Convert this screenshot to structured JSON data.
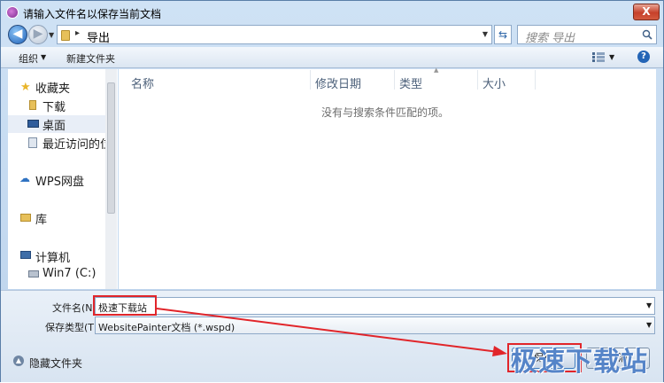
{
  "window": {
    "title": "请输入文件名以保存当前文档",
    "close_label": "X"
  },
  "address": {
    "path_separator": "▸",
    "current_folder": "导出",
    "search_placeholder": "搜索 导出"
  },
  "toolbar": {
    "organize_label": "组织",
    "new_folder_label": "新建文件夹"
  },
  "sidebar": {
    "items": [
      {
        "label": "收藏夹",
        "icon": "star-icon"
      },
      {
        "label": "下载",
        "icon": "folder-icon"
      },
      {
        "label": "桌面",
        "icon": "desktop-icon"
      },
      {
        "label": "最近访问的位置",
        "icon": "recent-places-icon"
      },
      {
        "label": "WPS网盘",
        "icon": "cloud-icon"
      },
      {
        "label": "库",
        "icon": "library-icon"
      },
      {
        "label": "计算机",
        "icon": "computer-icon"
      },
      {
        "label": "Win7 (C:)",
        "icon": "drive-icon"
      }
    ]
  },
  "filelist": {
    "columns": [
      "名称",
      "修改日期",
      "类型",
      "大小"
    ],
    "empty_message": "没有与搜索条件匹配的项。"
  },
  "form": {
    "filename_label": "文件名(N):",
    "filename_value": "极速下载站",
    "filetype_label": "保存类型(T):",
    "filetype_value": "WebsitePainter文档 (*.wspd)"
  },
  "footer": {
    "hide_folders_label": "隐藏文件夹",
    "save_label": "保存",
    "cancel_label": "取消"
  },
  "watermark": "极速下载站",
  "colors": {
    "annotation": "#e1252a",
    "accent": "#2465b6"
  }
}
